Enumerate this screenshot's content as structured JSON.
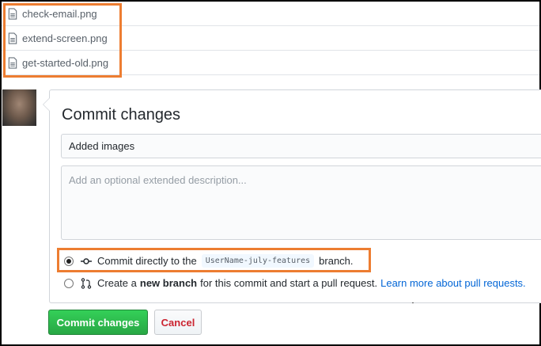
{
  "files": [
    {
      "name": "check-email.png",
      "icon": "file-icon"
    },
    {
      "name": "extend-screen.png",
      "icon": "file-icon"
    },
    {
      "name": "get-started-old.png",
      "icon": "file-icon"
    }
  ],
  "commit": {
    "title": "Commit changes",
    "summary_value": "Added images",
    "description_placeholder": "Add an optional extended description...",
    "option_direct": {
      "prefix": "Commit directly to the",
      "branch": "UserName-july-features",
      "suffix": "branch.",
      "checked": true
    },
    "option_new": {
      "prefix": "Create a",
      "bold": "new branch",
      "suffix": "for this commit and start a pull request.",
      "link": "Learn more about pull requests.",
      "checked": false
    }
  },
  "buttons": {
    "commit_label": "Commit changes",
    "cancel_label": "Cancel"
  },
  "colors": {
    "highlight": "#ed7d31",
    "primary": "#28a745",
    "danger": "#cb2431",
    "link": "#0366d6"
  }
}
